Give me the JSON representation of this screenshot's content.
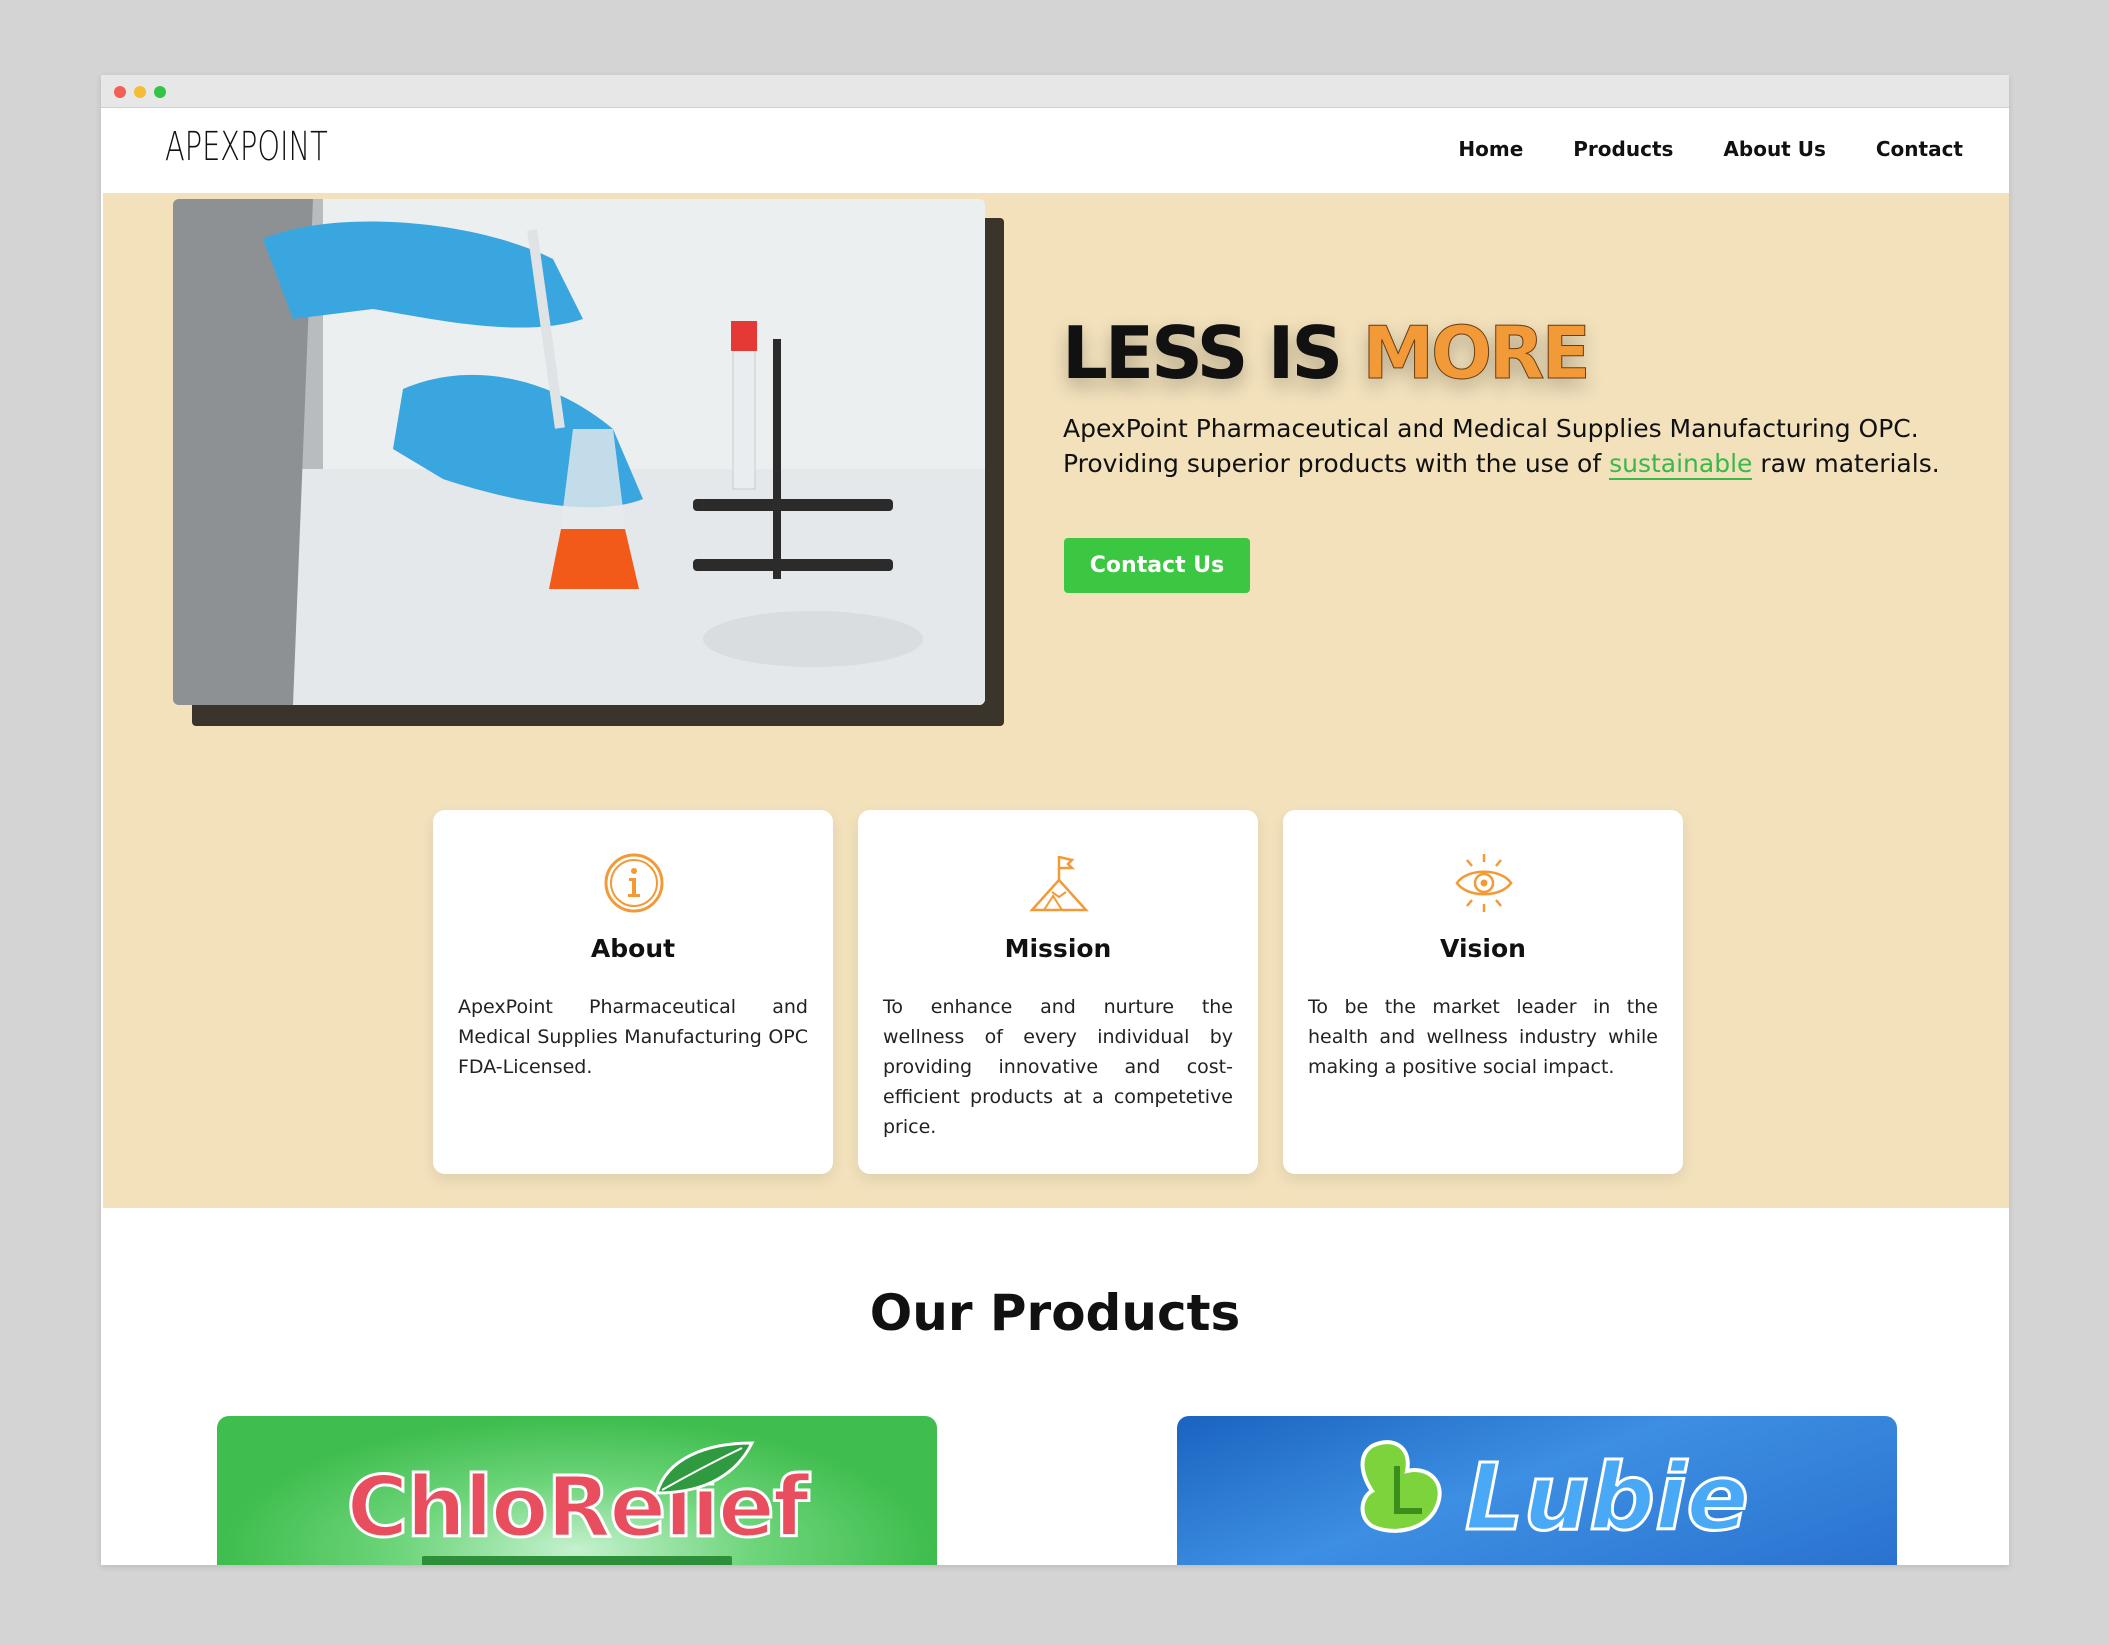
{
  "nav": {
    "logo": "APEXPOINT",
    "links": [
      "Home",
      "Products",
      "About Us",
      "Contact"
    ]
  },
  "hero": {
    "title_main": "LESS IS",
    "title_accent": "MORE",
    "line1": "ApexPoint Pharmaceutical and Medical Supplies Manufacturing OPC.",
    "line2_pre": "Providing superior products with the use of",
    "line2_highlight": "sustainable",
    "line2_post": "raw materials.",
    "cta": "Contact Us",
    "accent_color": "#f29a38",
    "highlight_color": "#38b94a"
  },
  "cards": [
    {
      "icon": "info-icon",
      "title": "About",
      "text": "ApexPoint Pharmaceutical and Medical Supplies Manufacturing OPC FDA-Licensed."
    },
    {
      "icon": "mountain-flag-icon",
      "title": "Mission",
      "text": "To enhance and nurture the wellness of every individual by providing innovative and cost-efficient products at a competetive price."
    },
    {
      "icon": "eye-icon",
      "title": "Vision",
      "text": "To be the market leader in the health and wellness industry while making a positive social impact."
    }
  ],
  "products": {
    "heading": "Our Products",
    "items": [
      "ChloRelief",
      "Lubie"
    ]
  }
}
